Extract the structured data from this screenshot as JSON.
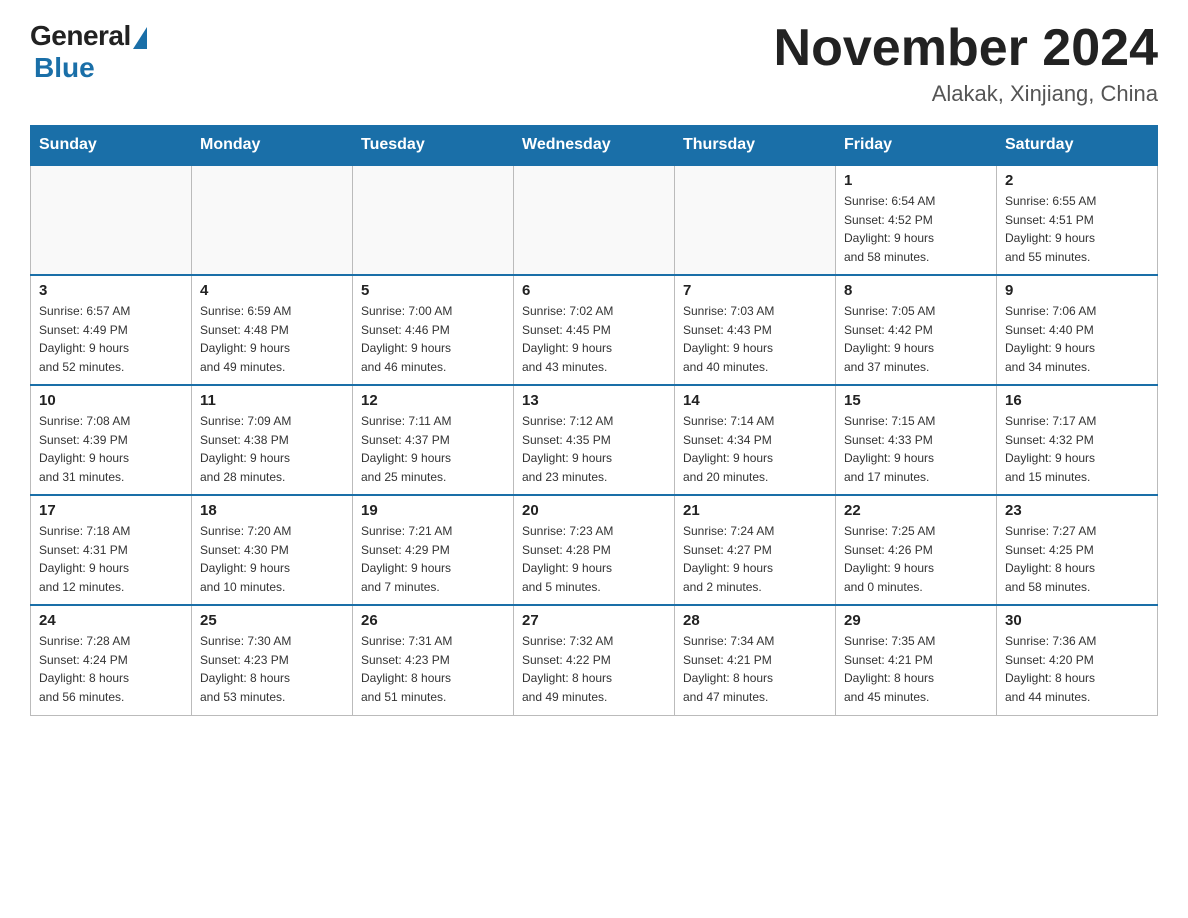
{
  "header": {
    "logo_general": "General",
    "logo_blue": "Blue",
    "month_title": "November 2024",
    "location": "Alakak, Xinjiang, China"
  },
  "weekdays": [
    "Sunday",
    "Monday",
    "Tuesday",
    "Wednesday",
    "Thursday",
    "Friday",
    "Saturday"
  ],
  "weeks": [
    [
      {
        "day": "",
        "info": ""
      },
      {
        "day": "",
        "info": ""
      },
      {
        "day": "",
        "info": ""
      },
      {
        "day": "",
        "info": ""
      },
      {
        "day": "",
        "info": ""
      },
      {
        "day": "1",
        "info": "Sunrise: 6:54 AM\nSunset: 4:52 PM\nDaylight: 9 hours\nand 58 minutes."
      },
      {
        "day": "2",
        "info": "Sunrise: 6:55 AM\nSunset: 4:51 PM\nDaylight: 9 hours\nand 55 minutes."
      }
    ],
    [
      {
        "day": "3",
        "info": "Sunrise: 6:57 AM\nSunset: 4:49 PM\nDaylight: 9 hours\nand 52 minutes."
      },
      {
        "day": "4",
        "info": "Sunrise: 6:59 AM\nSunset: 4:48 PM\nDaylight: 9 hours\nand 49 minutes."
      },
      {
        "day": "5",
        "info": "Sunrise: 7:00 AM\nSunset: 4:46 PM\nDaylight: 9 hours\nand 46 minutes."
      },
      {
        "day": "6",
        "info": "Sunrise: 7:02 AM\nSunset: 4:45 PM\nDaylight: 9 hours\nand 43 minutes."
      },
      {
        "day": "7",
        "info": "Sunrise: 7:03 AM\nSunset: 4:43 PM\nDaylight: 9 hours\nand 40 minutes."
      },
      {
        "day": "8",
        "info": "Sunrise: 7:05 AM\nSunset: 4:42 PM\nDaylight: 9 hours\nand 37 minutes."
      },
      {
        "day": "9",
        "info": "Sunrise: 7:06 AM\nSunset: 4:40 PM\nDaylight: 9 hours\nand 34 minutes."
      }
    ],
    [
      {
        "day": "10",
        "info": "Sunrise: 7:08 AM\nSunset: 4:39 PM\nDaylight: 9 hours\nand 31 minutes."
      },
      {
        "day": "11",
        "info": "Sunrise: 7:09 AM\nSunset: 4:38 PM\nDaylight: 9 hours\nand 28 minutes."
      },
      {
        "day": "12",
        "info": "Sunrise: 7:11 AM\nSunset: 4:37 PM\nDaylight: 9 hours\nand 25 minutes."
      },
      {
        "day": "13",
        "info": "Sunrise: 7:12 AM\nSunset: 4:35 PM\nDaylight: 9 hours\nand 23 minutes."
      },
      {
        "day": "14",
        "info": "Sunrise: 7:14 AM\nSunset: 4:34 PM\nDaylight: 9 hours\nand 20 minutes."
      },
      {
        "day": "15",
        "info": "Sunrise: 7:15 AM\nSunset: 4:33 PM\nDaylight: 9 hours\nand 17 minutes."
      },
      {
        "day": "16",
        "info": "Sunrise: 7:17 AM\nSunset: 4:32 PM\nDaylight: 9 hours\nand 15 minutes."
      }
    ],
    [
      {
        "day": "17",
        "info": "Sunrise: 7:18 AM\nSunset: 4:31 PM\nDaylight: 9 hours\nand 12 minutes."
      },
      {
        "day": "18",
        "info": "Sunrise: 7:20 AM\nSunset: 4:30 PM\nDaylight: 9 hours\nand 10 minutes."
      },
      {
        "day": "19",
        "info": "Sunrise: 7:21 AM\nSunset: 4:29 PM\nDaylight: 9 hours\nand 7 minutes."
      },
      {
        "day": "20",
        "info": "Sunrise: 7:23 AM\nSunset: 4:28 PM\nDaylight: 9 hours\nand 5 minutes."
      },
      {
        "day": "21",
        "info": "Sunrise: 7:24 AM\nSunset: 4:27 PM\nDaylight: 9 hours\nand 2 minutes."
      },
      {
        "day": "22",
        "info": "Sunrise: 7:25 AM\nSunset: 4:26 PM\nDaylight: 9 hours\nand 0 minutes."
      },
      {
        "day": "23",
        "info": "Sunrise: 7:27 AM\nSunset: 4:25 PM\nDaylight: 8 hours\nand 58 minutes."
      }
    ],
    [
      {
        "day": "24",
        "info": "Sunrise: 7:28 AM\nSunset: 4:24 PM\nDaylight: 8 hours\nand 56 minutes."
      },
      {
        "day": "25",
        "info": "Sunrise: 7:30 AM\nSunset: 4:23 PM\nDaylight: 8 hours\nand 53 minutes."
      },
      {
        "day": "26",
        "info": "Sunrise: 7:31 AM\nSunset: 4:23 PM\nDaylight: 8 hours\nand 51 minutes."
      },
      {
        "day": "27",
        "info": "Sunrise: 7:32 AM\nSunset: 4:22 PM\nDaylight: 8 hours\nand 49 minutes."
      },
      {
        "day": "28",
        "info": "Sunrise: 7:34 AM\nSunset: 4:21 PM\nDaylight: 8 hours\nand 47 minutes."
      },
      {
        "day": "29",
        "info": "Sunrise: 7:35 AM\nSunset: 4:21 PM\nDaylight: 8 hours\nand 45 minutes."
      },
      {
        "day": "30",
        "info": "Sunrise: 7:36 AM\nSunset: 4:20 PM\nDaylight: 8 hours\nand 44 minutes."
      }
    ]
  ]
}
